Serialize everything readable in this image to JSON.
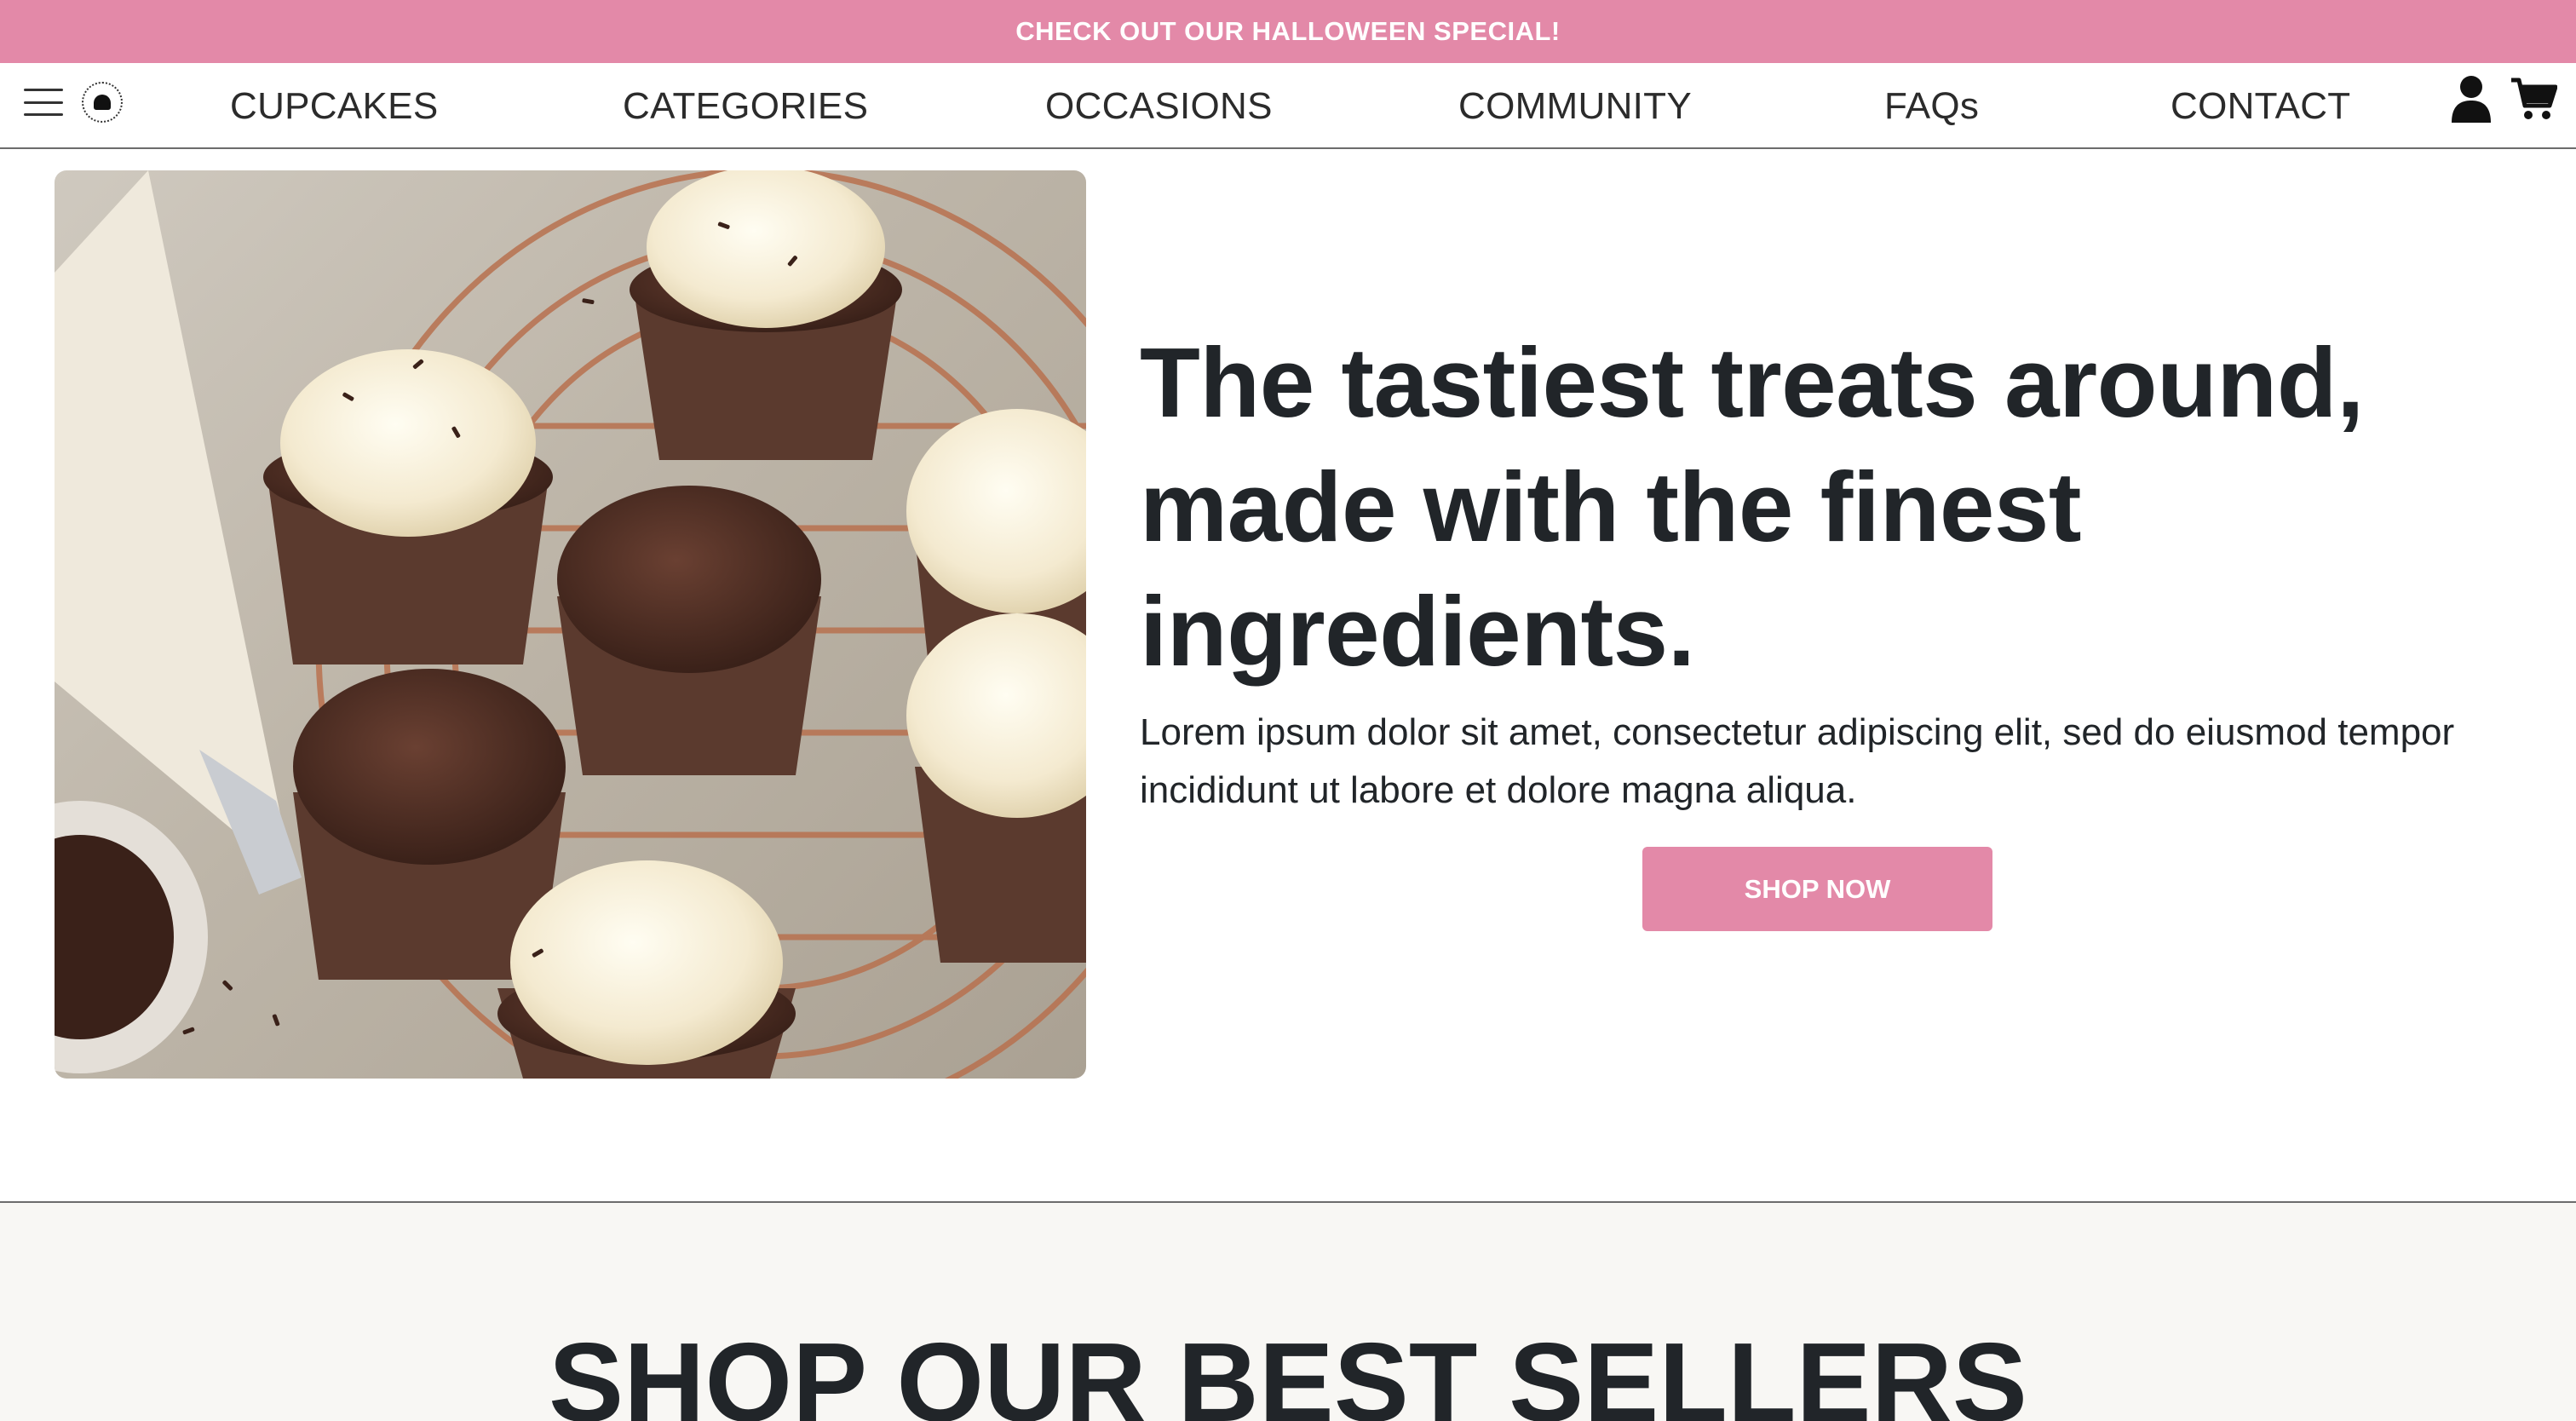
{
  "promo": {
    "text": "CHECK OUT OUR HALLOWEEN SPECIAL!"
  },
  "nav": {
    "items": [
      "CUPCAKES",
      "CATEGORIES",
      "OCCASIONS",
      "COMMUNITY",
      "FAQs",
      "CONTACT"
    ],
    "icons": {
      "menu": "hamburger-icon",
      "logo": "cupcake-logo",
      "account": "user-icon",
      "cart": "cart-icon"
    }
  },
  "hero": {
    "headline": "The tastiest treats around, made with the finest ingredients.",
    "text": "Lorem ipsum dolor sit amet, consectetur adipiscing elit, sed do eiusmod tempor incididunt ut labore et dolore magna aliqua.",
    "cta": "SHOP NOW"
  },
  "best_sellers": {
    "heading": "SHOP OUR BEST SELLERS"
  },
  "colors": {
    "accent": "#e389a8",
    "text": "#212529",
    "section_bg": "#f8f7f4"
  }
}
